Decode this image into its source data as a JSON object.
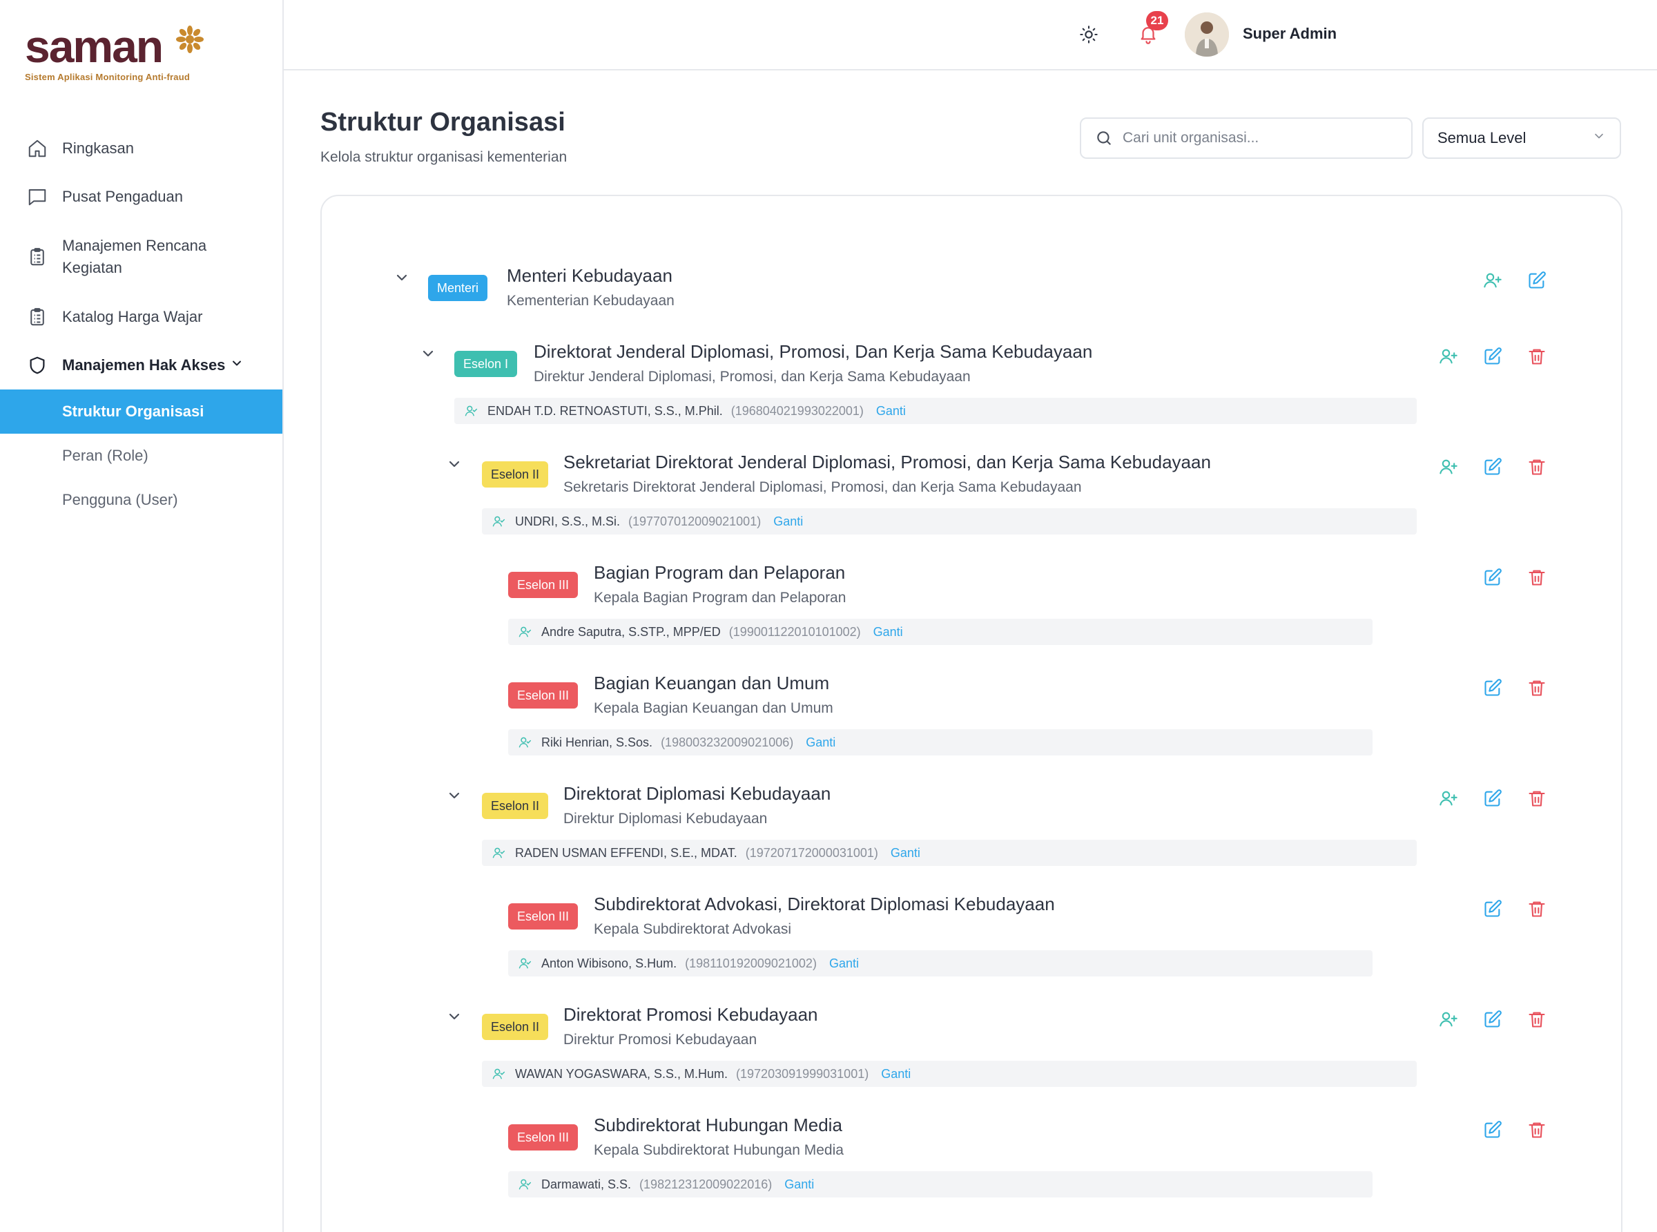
{
  "brand": {
    "name": "saman",
    "tagline": "Sistem Aplikasi Monitoring Anti-fraud"
  },
  "sidebar": {
    "items": [
      {
        "label": "Ringkasan",
        "icon": "home-icon"
      },
      {
        "label": "Pusat Pengaduan",
        "icon": "chat-icon"
      },
      {
        "label": "Manajemen Rencana Kegiatan",
        "icon": "clipboard-icon"
      },
      {
        "label": "Katalog Harga Wajar",
        "icon": "clipboard-icon"
      },
      {
        "label": "Manajemen Hak Akses",
        "icon": "shield-icon"
      }
    ],
    "sub_items": [
      {
        "label": "Struktur Organisasi",
        "active": true
      },
      {
        "label": "Peran (Role)"
      },
      {
        "label": "Pengguna (User)"
      }
    ]
  },
  "header": {
    "notification_count": "21",
    "user_name": "Super Admin"
  },
  "page": {
    "title": "Struktur Organisasi",
    "subtitle": "Kelola struktur organisasi kementerian",
    "search_placeholder": "Cari unit organisasi...",
    "level_filter": "Semua Level"
  },
  "colors": {
    "accent": "#2ea6ea",
    "menteri": "#2ea6ea",
    "eselon_1": "#3ebfb0",
    "eselon_2": "#f6de5a",
    "eselon_3": "#ec5a5f",
    "delete": "#e8505b"
  },
  "tree": [
    {
      "level": "Menteri",
      "title": "Menteri Kebudayaan",
      "subtitle": "Kementerian Kebudayaan"
    },
    {
      "level": "Eselon I",
      "title": "Direktorat Jenderal Diplomasi, Promosi, Dan Kerja Sama Kebudayaan",
      "subtitle": "Direktur Jenderal Diplomasi, Promosi, dan Kerja Sama Kebudayaan",
      "holder": "ENDAH T.D. RETNOASTUTI, S.S., M.Phil.",
      "nip": "(196804021993022001)",
      "change": "Ganti"
    },
    {
      "level": "Eselon II",
      "title": "Sekretariat Direktorat Jenderal Diplomasi, Promosi, dan Kerja Sama Kebudayaan",
      "subtitle": "Sekretaris Direktorat Jenderal Diplomasi, Promosi, dan Kerja Sama Kebudayaan",
      "holder": "UNDRI, S.S., M.Si.",
      "nip": "(197707012009021001)",
      "change": "Ganti"
    },
    {
      "level": "Eselon III",
      "title": "Bagian Program dan Pelaporan",
      "subtitle": "Kepala Bagian Program dan Pelaporan",
      "holder": "Andre Saputra, S.STP., MPP/ED",
      "nip": "(199001122010101002)",
      "change": "Ganti"
    },
    {
      "level": "Eselon III",
      "title": "Bagian Keuangan dan Umum",
      "subtitle": "Kepala Bagian Keuangan dan Umum",
      "holder": "Riki Henrian, S.Sos.",
      "nip": "(198003232009021006)",
      "change": "Ganti"
    },
    {
      "level": "Eselon II",
      "title": "Direktorat Diplomasi Kebudayaan",
      "subtitle": "Direktur Diplomasi Kebudayaan",
      "holder": "RADEN USMAN EFFENDI, S.E., MDAT.",
      "nip": "(197207172000031001)",
      "change": "Ganti"
    },
    {
      "level": "Eselon III",
      "title": "Subdirektorat Advokasi, Direktorat Diplomasi Kebudayaan",
      "subtitle": "Kepala Subdirektorat Advokasi",
      "holder": "Anton Wibisono, S.Hum.",
      "nip": "(198110192009021002)",
      "change": "Ganti"
    },
    {
      "level": "Eselon II",
      "title": "Direktorat Promosi Kebudayaan",
      "subtitle": "Direktur Promosi Kebudayaan",
      "holder": "WAWAN YOGASWARA, S.S., M.Hum.",
      "nip": "(197203091999031001)",
      "change": "Ganti"
    },
    {
      "level": "Eselon III",
      "title": "Subdirektorat Hubungan Media",
      "subtitle": "Kepala Subdirektorat Hubungan Media",
      "holder": "Darmawati, S.S.",
      "nip": "(198212312009022016)",
      "change": "Ganti"
    }
  ]
}
